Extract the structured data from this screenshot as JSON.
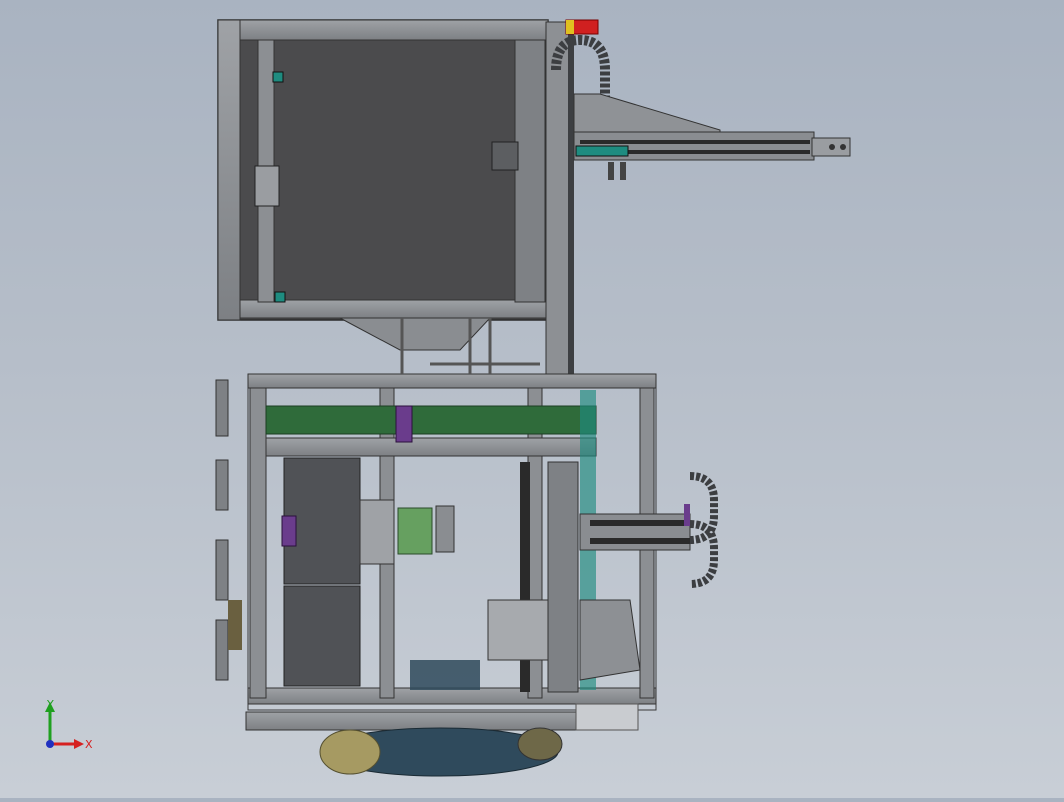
{
  "viewport": {
    "background_top": "#a9b3c1",
    "background_bottom": "#c8ced6"
  },
  "triad": {
    "x_label": "X",
    "y_label": "Y",
    "x_color": "#d62020",
    "y_color": "#1fa01f",
    "z_color": "#2030c0"
  },
  "model": {
    "frame_color": "#8f9296",
    "panel_color": "#4a4a4c",
    "accent_green": "#2f6b3a",
    "accent_teal": "#1e8c80",
    "accent_purple": "#6a3c8c",
    "stop_button_color": "#d02020"
  }
}
